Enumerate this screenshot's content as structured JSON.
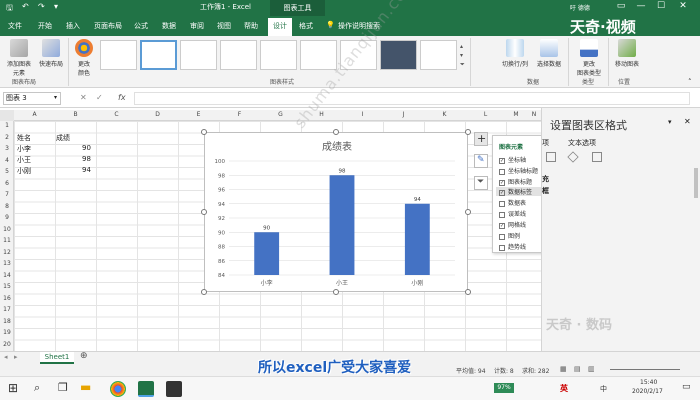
{
  "titlebar": {
    "file_title": "工作簿1 - Excel",
    "context_group": "图表工具",
    "user": "吁 德德",
    "minimize": "—",
    "maximize": "☐",
    "close": "✕"
  },
  "tabs": [
    "文件",
    "开始",
    "插入",
    "页面布局",
    "公式",
    "数据",
    "审阅",
    "视图",
    "帮助",
    "设计",
    "格式"
  ],
  "tell_me": "操作说明搜索",
  "brand": {
    "logo_text": "天奇·视频",
    "bottom_logo": "天奇 · 数码"
  },
  "ribbon": {
    "add_element": "添加图表\n元素",
    "quick_layout": "快速布局",
    "change_colors": "更改\n颜色",
    "group_layout": "图表布局",
    "group_styles": "图表样式",
    "switch_row_col": "切换行/列",
    "select_data": "选择数据",
    "group_data": "数据",
    "change_type": "更改\n图表类型",
    "group_type": "类型",
    "move_chart": "移动图表",
    "group_location": "位置"
  },
  "formula_bar": {
    "name_box": "图表 3",
    "fx": "fx"
  },
  "columns": [
    "A",
    "B",
    "C",
    "D",
    "E",
    "F",
    "G",
    "H",
    "I",
    "J",
    "K",
    "L",
    "M",
    "N"
  ],
  "rows": [
    "1",
    "2",
    "3",
    "4",
    "5",
    "6",
    "7",
    "8",
    "9",
    "10",
    "11",
    "12",
    "13",
    "14",
    "15",
    "16",
    "17",
    "18",
    "19",
    "20"
  ],
  "cells": {
    "a2": "姓名",
    "b2": "成绩",
    "a3": "小李",
    "b3": "90",
    "a4": "小王",
    "b4": "98",
    "a5": "小刚",
    "b5": "94"
  },
  "chart_data": {
    "type": "bar",
    "title": "成绩表",
    "categories": [
      "小李",
      "小王",
      "小刚"
    ],
    "values": [
      90,
      98,
      94
    ],
    "ylim": [
      84,
      100
    ],
    "yticks": [
      84,
      86,
      88,
      90,
      92,
      94,
      96,
      98,
      100
    ],
    "color": "#4472c4",
    "grid": true,
    "legend": "none"
  },
  "chart_elements_popup": {
    "header": "图表元素",
    "items": [
      {
        "label": "坐标轴",
        "checked": true
      },
      {
        "label": "坐标轴标题",
        "checked": false
      },
      {
        "label": "图表标题",
        "checked": true
      },
      {
        "label": "数据标签",
        "checked": true
      },
      {
        "label": "数据表",
        "checked": false
      },
      {
        "label": "误差线",
        "checked": false
      },
      {
        "label": "网格线",
        "checked": true
      },
      {
        "label": "图例",
        "checked": false
      },
      {
        "label": "趋势线",
        "checked": false
      }
    ]
  },
  "format_pane": {
    "title": "设置图表区格式",
    "tab_options": "项",
    "tab_text": "文本选项",
    "section_a": "充",
    "section_b": "框"
  },
  "sheet_tab": "Sheet1",
  "status": {
    "average": "平均值: 94",
    "count": "计数: 8",
    "sum": "求和: 282"
  },
  "subtitle_overlay": "所以excel广受大家喜爱",
  "watermark": "shuma.tianqijun.com",
  "taskbar": {
    "battery": "97%",
    "time": "15:40",
    "date": "2020/2/17",
    "ime": "英",
    "ime2": "中"
  }
}
